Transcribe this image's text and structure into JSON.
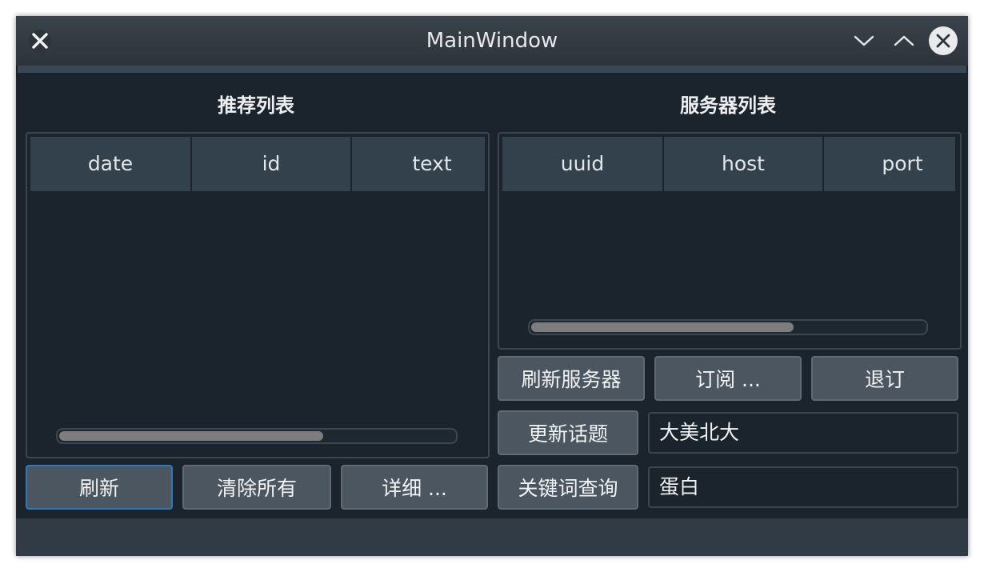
{
  "window": {
    "title": "MainWindow"
  },
  "left": {
    "title": "推荐列表",
    "columns": [
      "date",
      "id",
      "text"
    ],
    "scrollbar_position": 0.66,
    "buttons": {
      "refresh": "刷新",
      "clear_all": "清除所有",
      "details": "详细 ..."
    }
  },
  "right": {
    "title": "服务器列表",
    "columns": [
      "uuid",
      "host",
      "port"
    ],
    "scrollbar_position": 0.66,
    "buttons": {
      "refresh_servers": "刷新服务器",
      "subscribe": "订阅 ...",
      "unsubscribe": "退订",
      "update_topic": "更新话题",
      "keyword_query": "关键词查询"
    },
    "fields": {
      "topic_value": "大美北大",
      "keyword_value": "蛋白"
    }
  },
  "icons": [
    "close-icon",
    "minimize-icon",
    "maximize-icon",
    "close-circle-icon"
  ]
}
